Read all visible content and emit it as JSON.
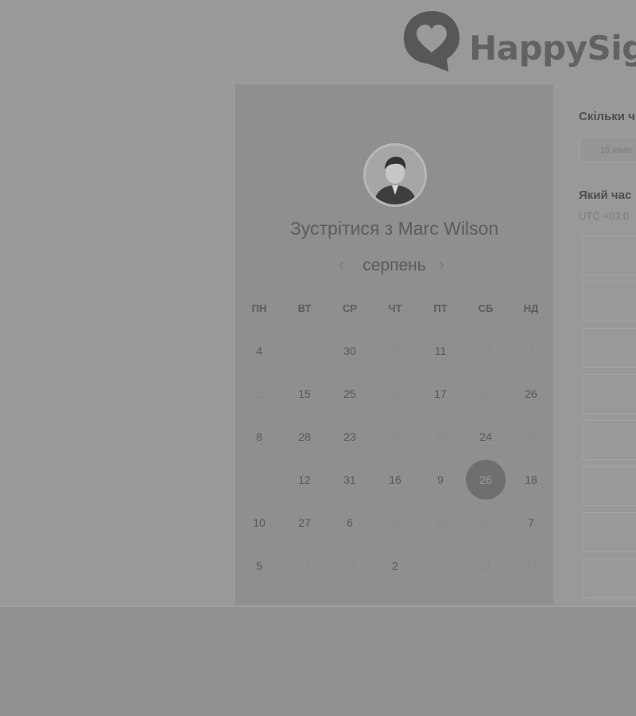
{
  "brand": {
    "name": "HappySig"
  },
  "colors": {
    "overlay": "#929292",
    "panel": "#8f8f8f",
    "accent_selected": "#6f6f6f"
  },
  "profile": {
    "avatar_icon": "person-photo",
    "title": "Зустрітися з Marc Wilson"
  },
  "calendar": {
    "month": "серпень",
    "prev_icon": "chevron-left",
    "next_icon": "chevron-right",
    "weekdays": [
      "ПН",
      "ВТ",
      "СР",
      "ЧТ",
      "ПТ",
      "СБ",
      "НД"
    ],
    "weeks": [
      [
        {
          "d": "4",
          "on": true
        },
        {
          "d": "16",
          "on": false
        },
        {
          "d": "30",
          "on": true
        },
        {
          "d": "25",
          "on": false
        },
        {
          "d": "11",
          "on": true
        },
        {
          "d": "22",
          "on": false
        },
        {
          "d": "3",
          "on": false
        }
      ],
      [
        {
          "d": "25",
          "on": false
        },
        {
          "d": "15",
          "on": true
        },
        {
          "d": "25",
          "on": true
        },
        {
          "d": "11",
          "on": false
        },
        {
          "d": "17",
          "on": true
        },
        {
          "d": "18",
          "on": false
        },
        {
          "d": "26",
          "on": true
        }
      ],
      [
        {
          "d": "8",
          "on": true
        },
        {
          "d": "28",
          "on": true
        },
        {
          "d": "23",
          "on": true
        },
        {
          "d": "29",
          "on": false
        },
        {
          "d": "30",
          "on": false
        },
        {
          "d": "24",
          "on": true
        },
        {
          "d": "25",
          "on": false
        }
      ],
      [
        {
          "d": "10",
          "on": false
        },
        {
          "d": "12",
          "on": true
        },
        {
          "d": "31",
          "on": true
        },
        {
          "d": "16",
          "on": true
        },
        {
          "d": "9",
          "on": true
        },
        {
          "d": "26",
          "on": true,
          "selected": true
        },
        {
          "d": "18",
          "on": true
        }
      ],
      [
        {
          "d": "10",
          "on": true
        },
        {
          "d": "27",
          "on": true
        },
        {
          "d": "6",
          "on": true
        },
        {
          "d": "11",
          "on": false
        },
        {
          "d": "18",
          "on": false
        },
        {
          "d": "16",
          "on": false
        },
        {
          "d": "7",
          "on": true
        }
      ],
      [
        {
          "d": "5",
          "on": true
        },
        {
          "d": "12",
          "on": false
        },
        {
          "d": "29",
          "on": false
        },
        {
          "d": "2",
          "on": true
        },
        {
          "d": "29",
          "on": false
        },
        {
          "d": "11",
          "on": false
        },
        {
          "d": "14",
          "on": false
        }
      ]
    ]
  },
  "scheduler": {
    "duration_question": "Скільки ч",
    "duration_value": "15 хвил",
    "time_question": "Який час",
    "timezone": "UTC +03:0",
    "slot_count": 8
  }
}
